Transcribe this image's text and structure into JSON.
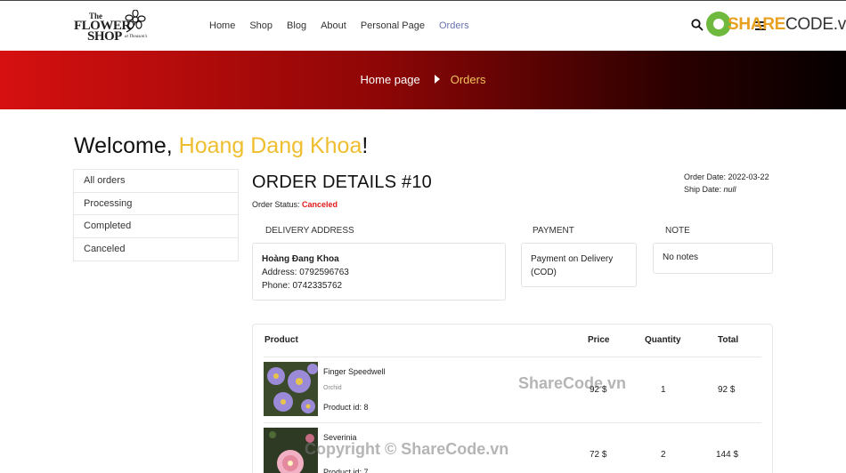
{
  "header": {
    "logo": {
      "line1": "The",
      "line2": "FLOWER",
      "line3": "SHOP",
      "tagline": "at Thoason's"
    },
    "nav": [
      "Home",
      "Shop",
      "Blog",
      "About",
      "Personal Page",
      "Orders"
    ],
    "active_nav": "Orders",
    "brand": {
      "part1": "SHARE",
      "part2": "CODE.vn"
    }
  },
  "hero": {
    "crumb_home": "Home page",
    "crumb_current": "Orders"
  },
  "welcome": {
    "prefix": "Welcome, ",
    "name": "Hoang Dang Khoa",
    "suffix": "!"
  },
  "sidebar": {
    "items": [
      "All orders",
      "Processing",
      "Completed",
      "Canceled"
    ]
  },
  "order": {
    "title": "ORDER DETAILS #10",
    "status_label": "Order Status: ",
    "status": "Canceled",
    "order_date_label": "Order Date: ",
    "order_date": "2022-03-22",
    "ship_date_label": "Ship Date: ",
    "ship_date": "null"
  },
  "delivery": {
    "heading": "DELIVERY ADDRESS",
    "name": "Hoàng Đang Khoa",
    "address": "Address: 0792596763",
    "phone": "Phone: 0742335762"
  },
  "payment": {
    "heading": "PAYMENT",
    "method": "Payment on Delivery (COD)"
  },
  "note": {
    "heading": "NOTE",
    "text": "No notes"
  },
  "table": {
    "headers": {
      "product": "Product",
      "price": "Price",
      "quantity": "Quantity",
      "total": "Total"
    },
    "rows": [
      {
        "name": "Finger Speedwell",
        "category": "Orchid",
        "id": "Product id: 8",
        "price": "92 $",
        "quantity": "1",
        "total": "92 $"
      },
      {
        "name": "Severinia",
        "category": "",
        "id": "Product id: 7",
        "price": "72 $",
        "quantity": "2",
        "total": "144 $"
      }
    ]
  },
  "watermarks": {
    "w1": "ShareCode.vn",
    "w2": "Copyright © ShareCode.vn"
  },
  "colors": {
    "accent_yellow": "#efbe2e",
    "status_red": "#e21a1a",
    "nav_active": "#6a72b5",
    "hero_red": "#d61010"
  }
}
